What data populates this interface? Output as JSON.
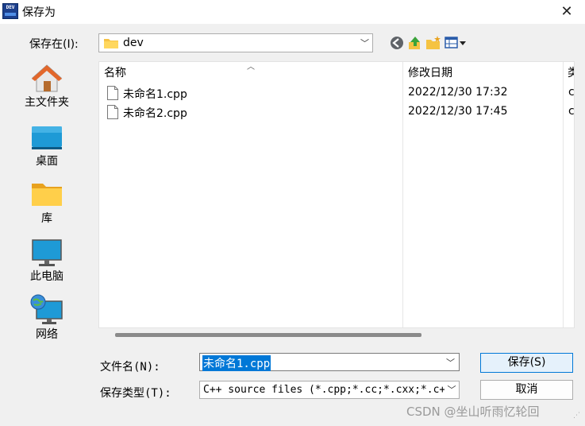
{
  "window": {
    "title": "保存为",
    "app_icon_text": "DEV",
    "close_glyph": "✕"
  },
  "savein": {
    "label": "保存在(I):",
    "value": "dev"
  },
  "places": [
    {
      "label": "主文件夹",
      "icon": "home-icon"
    },
    {
      "label": "桌面",
      "icon": "desktop-icon"
    },
    {
      "label": "库",
      "icon": "library-folder-icon"
    },
    {
      "label": "此电脑",
      "icon": "computer-icon"
    },
    {
      "label": "网络",
      "icon": "network-icon"
    }
  ],
  "filelist": {
    "columns": {
      "name": "名称",
      "date": "修改日期",
      "type": "类"
    },
    "rows": [
      {
        "name": "未命名1.cpp",
        "date": "2022/12/30 17:32",
        "type": "c"
      },
      {
        "name": "未命名2.cpp",
        "date": "2022/12/30 17:45",
        "type": "c"
      }
    ]
  },
  "filename": {
    "label": "文件名(N):",
    "value": "未命名1.cpp"
  },
  "filetype": {
    "label": "保存类型(T):",
    "value": "C++ source files (*.cpp;*.cc;*.cxx;*.c++;*.hpp;*.hh;*.h)"
  },
  "buttons": {
    "save": "保存(S)",
    "cancel": "取消"
  },
  "watermark": "CSDN @坐山听雨忆轮回",
  "colors": {
    "selection": "#0078d7",
    "default_button_bg": "#e5f1fb",
    "app_icon": "#1c3f8c"
  }
}
